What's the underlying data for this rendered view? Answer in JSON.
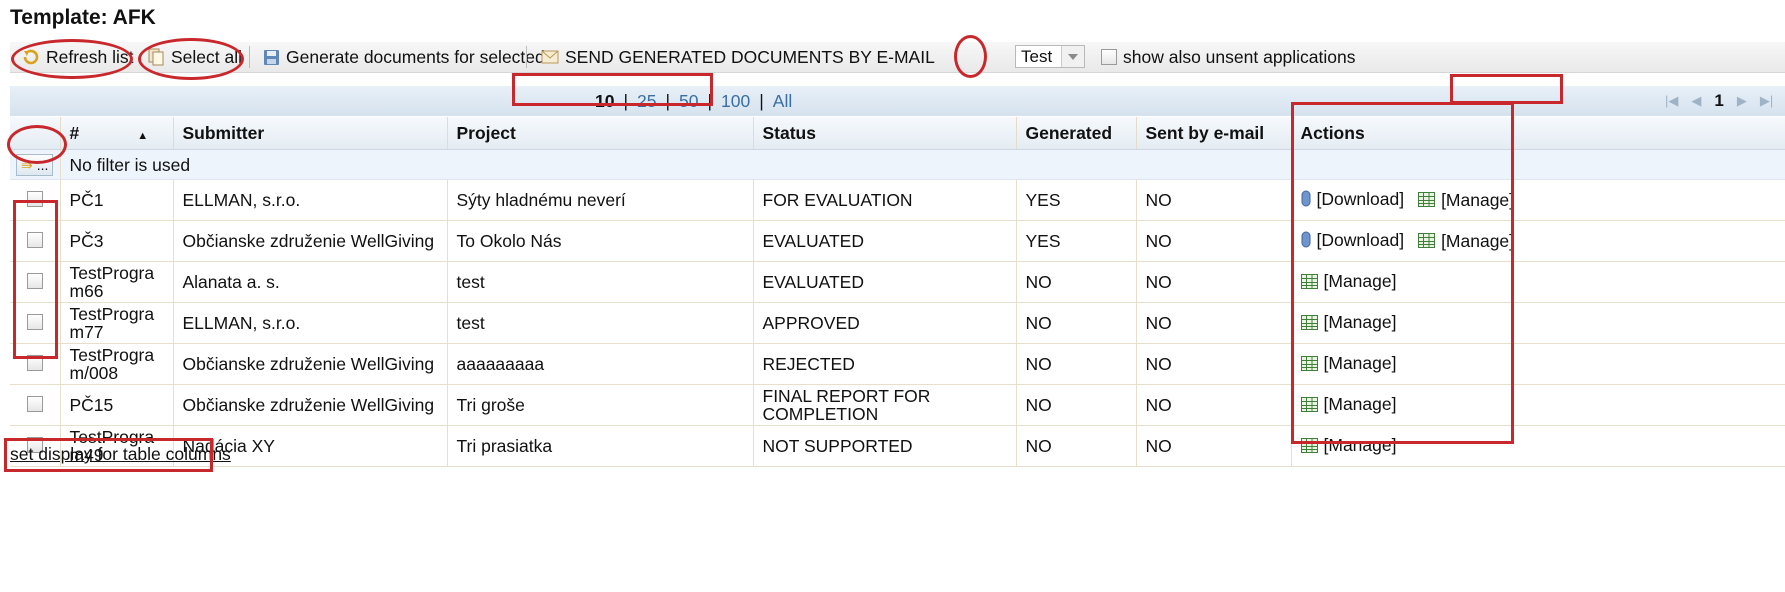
{
  "page": {
    "title": "Template: AFK"
  },
  "toolbar": {
    "refresh_label": "Refresh list",
    "select_all_label": "Select all",
    "generate_label": "Generate documents for selected",
    "send_label": "SEND GENERATED DOCUMENTS BY E-MAIL",
    "template_select_value": "Test",
    "unsent_label": "show also unsent applications"
  },
  "pager": {
    "page_sizes": {
      "current": "10",
      "s25": "25",
      "s50": "50",
      "s100": "100",
      "all": "All"
    },
    "current_page": "1"
  },
  "table": {
    "columns": {
      "number": "#",
      "submitter": "Submitter",
      "project": "Project",
      "status": "Status",
      "generated": "Generated",
      "sent": "Sent by e-mail",
      "actions": "Actions"
    },
    "filter": {
      "button_label": "...",
      "text": "No filter is used"
    },
    "rows": [
      {
        "number": "PČ1",
        "submitter": "ELLMAN, s.r.o.",
        "project": "Sýty hladnému neverí",
        "status": "FOR EVALUATION",
        "generated": "YES",
        "sent": "NO"
      },
      {
        "number": "PČ3",
        "submitter": "Občianske združenie WellGiving",
        "project": "To Okolo Nás",
        "status": "EVALUATED",
        "generated": "YES",
        "sent": "NO"
      },
      {
        "number": "TestProgram66",
        "submitter": "Alanata a. s.",
        "project": "test",
        "status": "EVALUATED",
        "generated": "NO",
        "sent": "NO"
      },
      {
        "number": "TestProgram77",
        "submitter": "ELLMAN, s.r.o.",
        "project": "test",
        "status": "APPROVED",
        "generated": "NO",
        "sent": "NO"
      },
      {
        "number": "TestProgram/008",
        "submitter": "Občianske združenie WellGiving",
        "project": "aaaaaaaaa",
        "status": "REJECTED",
        "generated": "NO",
        "sent": "NO"
      },
      {
        "number": "PČ15",
        "submitter": "Občianske združenie WellGiving",
        "project": "Tri groše",
        "status": "FINAL REPORT FOR COMPLETION",
        "generated": "NO",
        "sent": "NO"
      },
      {
        "number": "TestProgram49",
        "submitter": "Nadácia XY",
        "project": "Tri prasiatka",
        "status": "NOT SUPPORTED",
        "generated": "NO",
        "sent": "NO"
      }
    ],
    "actions": {
      "download": "[Download]",
      "manage": "[Manage]"
    }
  },
  "footer": {
    "column_settings_link": "set display for table columns"
  },
  "colors": {
    "annotation": "#c8272b",
    "link": "#3a6ea5",
    "pager_bg": "#dce7f1"
  }
}
